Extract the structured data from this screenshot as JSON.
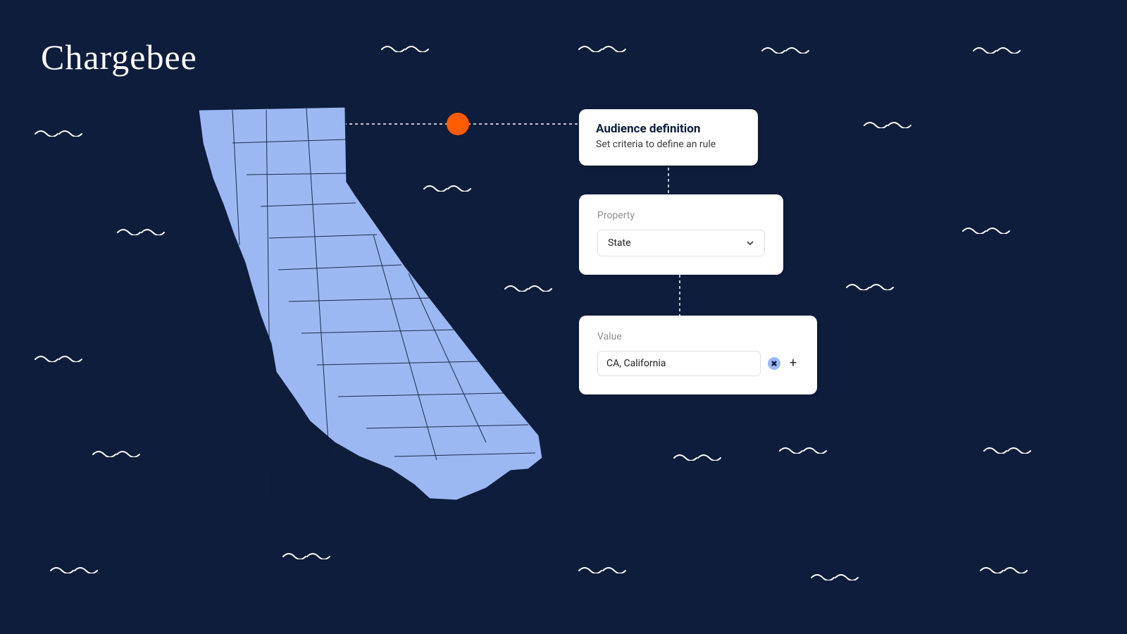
{
  "brand": {
    "name": "Chargebee"
  },
  "audience_card": {
    "title": "Audience definition",
    "subtitle": "Set criteria to define an rule"
  },
  "property_card": {
    "label": "Property",
    "selected": "State"
  },
  "value_card": {
    "label": "Value",
    "value": "CA, California"
  }
}
